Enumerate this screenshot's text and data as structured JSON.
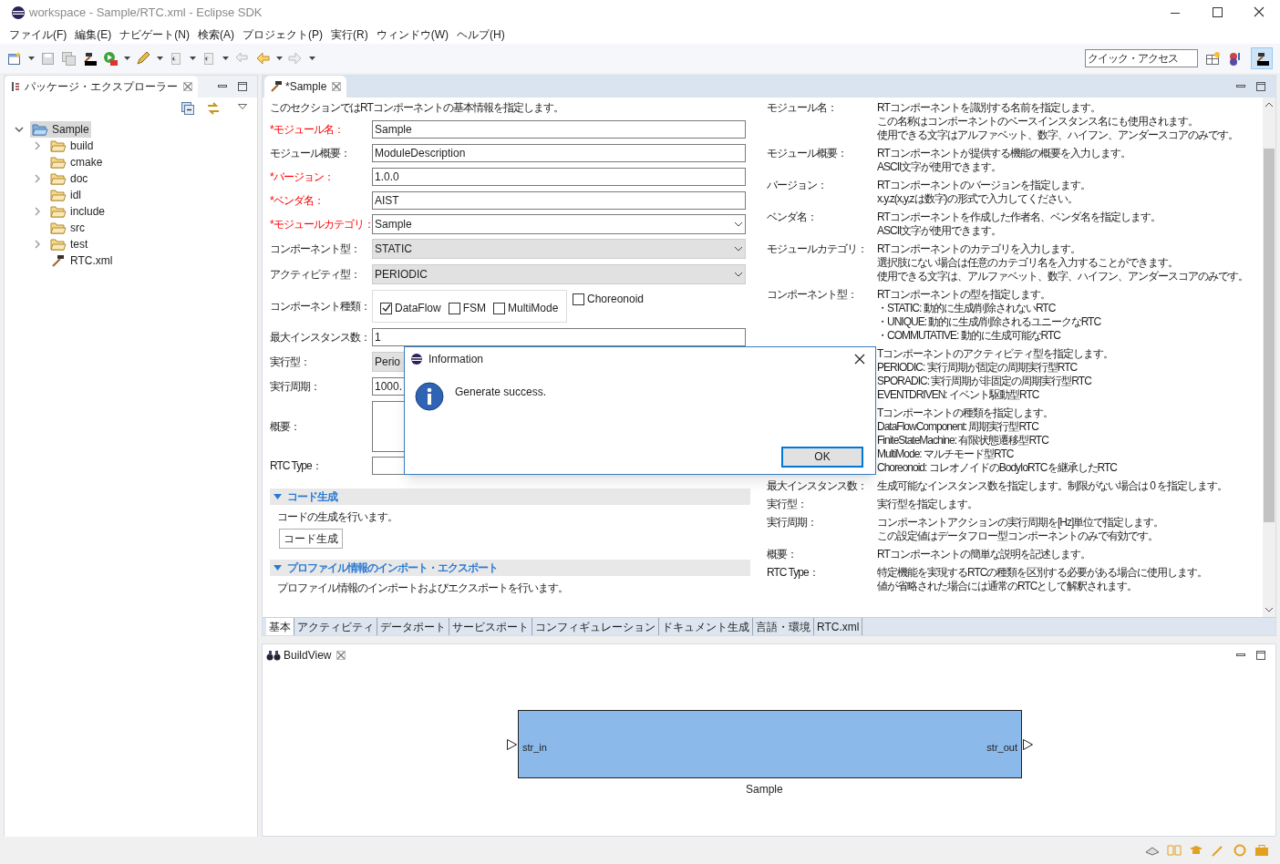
{
  "window": {
    "title": "workspace - Sample/RTC.xml - Eclipse SDK"
  },
  "menu": [
    "ファイル(F)",
    "編集(E)",
    "ナビゲート(N)",
    "検索(A)",
    "プロジェクト(P)",
    "実行(R)",
    "ウィンドウ(W)",
    "ヘルプ(H)"
  ],
  "quick_access": {
    "placeholder": "クイック・アクセス"
  },
  "explorer": {
    "title": "パッケージ・エクスプローラー",
    "tree": [
      {
        "label": "Sample",
        "kind": "project",
        "expandable": true,
        "expanded": true,
        "selected": true,
        "children": [
          {
            "label": "build",
            "kind": "folder",
            "expandable": true,
            "expanded": false,
            "selected": false
          },
          {
            "label": "cmake",
            "kind": "folder",
            "expandable": false,
            "selected": false
          },
          {
            "label": "doc",
            "kind": "folder",
            "expandable": true,
            "expanded": false,
            "selected": false
          },
          {
            "label": "idl",
            "kind": "folder",
            "expandable": false,
            "selected": false
          },
          {
            "label": "include",
            "kind": "folder",
            "expandable": true,
            "expanded": false,
            "selected": false
          },
          {
            "label": "src",
            "kind": "folder",
            "expandable": false,
            "selected": false
          },
          {
            "label": "test",
            "kind": "folder",
            "expandable": true,
            "expanded": false,
            "selected": false
          },
          {
            "label": "RTC.xml",
            "kind": "file",
            "expandable": false,
            "selected": false
          }
        ]
      }
    ]
  },
  "editor": {
    "tab": "*Sample",
    "intro": "このセクションではRTコンポーネントの基本情報を指定します。",
    "fields": [
      {
        "kind": "text",
        "label": "*モジュール名：",
        "required": true,
        "value": "Sample"
      },
      {
        "kind": "text",
        "label": "モジュール概要：",
        "required": false,
        "value": "ModuleDescription"
      },
      {
        "kind": "text",
        "label": "*バージョン：",
        "required": true,
        "value": "1.0.0"
      },
      {
        "kind": "text",
        "label": "*ベンダ名：",
        "required": true,
        "value": "AIST"
      },
      {
        "kind": "combo",
        "label": "*モジュールカテゴリ：",
        "required": true,
        "value": "Sample"
      },
      {
        "kind": "combo_disabled",
        "label": "コンポーネント型：",
        "required": false,
        "value": "STATIC"
      },
      {
        "kind": "combo_disabled",
        "label": "アクティビティ型：",
        "required": false,
        "value": "PERIODIC"
      },
      {
        "kind": "checks",
        "label": "コンポーネント種類：",
        "required": false,
        "options": [
          {
            "label": "DataFlow",
            "checked": true
          },
          {
            "label": "FSM",
            "checked": false
          },
          {
            "label": "MultiMode",
            "checked": false
          }
        ],
        "extra": {
          "label": "Choreonoid",
          "checked": false
        }
      },
      {
        "kind": "text",
        "label": "最大インスタンス数：",
        "required": false,
        "value": "1"
      },
      {
        "kind": "combo_disabled",
        "label": "実行型：",
        "required": false,
        "value": "Perio"
      },
      {
        "kind": "text",
        "label": "実行周期：",
        "required": false,
        "value": "1000."
      },
      {
        "kind": "textarea",
        "label": "概要：",
        "required": false
      },
      {
        "kind": "text",
        "label": "RTC Type：",
        "required": false
      }
    ],
    "sections": [
      {
        "title": "コード生成",
        "expanded": true,
        "text": "コードの生成を行います。",
        "button": "コード生成"
      },
      {
        "title": "プロファイル情報のインポート・エクスポート",
        "expanded": true,
        "text": "プロファイル情報のインポートおよびエクスポートを行います。"
      }
    ],
    "help": [
      {
        "label": "モジュール名：",
        "lines": [
          "RTコンポーネントを識別する名前を指定します。",
          "この名称はコンポーネントのベースインスタンス名にも使用されます。",
          "使用できる文字はアルファベット、数字、ハイフン、アンダースコアのみです。"
        ]
      },
      {
        "label": "モジュール概要：",
        "lines": [
          "RTコンポーネントが提供する機能の概要を入力します。",
          "ASCII文字が使用できます。"
        ]
      },
      {
        "label": "バージョン：",
        "lines": [
          "RTコンポーネントのバージョンを指定します。",
          "x.y.z(x,y,zは数字)の形式で入力してください。"
        ]
      },
      {
        "label": "ベンダ名：",
        "lines": [
          "RTコンポーネントを作成した作者名、ベンダ名を指定します。",
          "ASCII文字が使用できます。"
        ]
      },
      {
        "label": "モジュールカテゴリ：",
        "lines": [
          "RTコンポーネントのカテゴリを入力します。",
          "選択肢にない場合は任意のカテゴリ名を入力することができます。",
          "使用できる文字は、アルファベット、数字、ハイフン、アンダースコアのみです。"
        ]
      },
      {
        "label": "コンポーネント型：",
        "lines": [
          "RTコンポーネントの型を指定します。",
          "・STATIC: 動的に生成/削除されないRTC",
          "・UNIQUE: 動的に生成/削除されるユニークなRTC",
          "・COMMUTATIVE: 動的に生成可能なRTC"
        ]
      },
      {
        "lines": [
          "Tコンポーネントのアクティビティ型を指定します。",
          "PERIODIC: 実行周期が固定の周期実行型RTC",
          "SPORADIC: 実行周期が非固定の周期実行型RTC",
          "EVENTDRIVEN: イベント駆動型RTC"
        ]
      },
      {
        "lines": [
          "Tコンポーネントの種類を指定します。",
          "DataFlowComponent: 周期実行型RTC",
          "FiniteStateMachine: 有限状態遷移型RTC",
          "MultiMode: マルチモード型RTC",
          "Choreonoid: コレオノイドのBodyIoRTCを継承したRTC"
        ]
      },
      {
        "label": "最大インスタンス数：",
        "lines": [
          "生成可能なインスタンス数を指定します。制限がない場合は 0 を指定します。"
        ]
      },
      {
        "label": "実行型：",
        "lines": [
          "実行型を指定します。"
        ]
      },
      {
        "label": "実行周期：",
        "lines": [
          "コンポーネントアクションの実行周期を[Hz]単位で指定します。",
          "この設定値はデータフロー型コンポーネントのみで有効です。"
        ]
      },
      {
        "label": "概要：",
        "lines": [
          "RTコンポーネントの簡単な説明を記述します。"
        ]
      },
      {
        "label": "RTC Type：",
        "lines": [
          "特定機能を実現するRTCの種類を区別する必要がある場合に使用します。",
          "値が省略された場合には通常のRTCとして解釈されます。"
        ]
      }
    ],
    "tabs": [
      {
        "label": "基本",
        "selected": true
      },
      {
        "label": "アクティビティ",
        "selected": false
      },
      {
        "label": "データポート",
        "selected": false
      },
      {
        "label": "サービスポート",
        "selected": false
      },
      {
        "label": "コンフィギュレーション",
        "selected": false
      },
      {
        "label": "ドキュメント生成",
        "selected": false
      },
      {
        "label": "言語・環境",
        "selected": false
      },
      {
        "label": "RTC.xml",
        "selected": false
      }
    ]
  },
  "build_view": {
    "title": "BuildView",
    "component": {
      "name": "Sample",
      "input_port": {
        "name": "str_in"
      },
      "output_port": {
        "name": "str_out"
      }
    }
  },
  "dialog": {
    "title": "Information",
    "message": "Generate success.",
    "button": "OK"
  }
}
